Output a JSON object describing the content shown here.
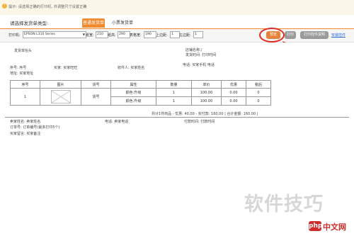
{
  "notice": {
    "icon": "info-icon",
    "text": "提示: 请选择正确的打印机, 并调整尺寸设置正确"
  },
  "type_selector": {
    "label": "请选择发货单类型:",
    "tabs": [
      {
        "label": "普通发货单",
        "active": true
      },
      {
        "label": "小票发货单",
        "active": false
      }
    ]
  },
  "print_settings": {
    "printer_label": "打印机:",
    "printer_value": "EPSON L310 Series",
    "width_label": "纸宽:",
    "width_value": "210",
    "height_label": "纸高:",
    "height_value": "290",
    "table_width_label": "表格宽:",
    "table_width_value": "190",
    "top_margin_label": "上边距:",
    "top_margin_value": "1",
    "left_margin_label": "左边距:",
    "left_margin_value": "1",
    "buttons": {
      "preview": "预览",
      "print": "打印",
      "control": "打印控件说明",
      "install": "安装控件"
    }
  },
  "document": {
    "title_left": "发货单抬头",
    "shop_name": "店铺名称:/",
    "send_time": "发货时间: 打印时间",
    "serial": "序号: 序号",
    "buyer": "买家: 买家旺旺",
    "buyer_name": "收件人: 买家姓名",
    "phone": "电话: 买家手机 电话",
    "address": "地址: 买家地址",
    "table": {
      "headers": [
        "序号",
        "图片",
        "货号",
        "属性",
        "数量",
        "单价",
        "优惠",
        "税后"
      ],
      "row_index": "1",
      "item_code": "货号",
      "sub_rows": [
        {
          "attr": "颜色:升级",
          "qty": "1",
          "price": "100.00",
          "discount": "0.00",
          "after": "0"
        },
        {
          "attr": "颜色:升级",
          "qty": "1",
          "price": "100.00",
          "discount": "0.00",
          "after": "0"
        }
      ]
    },
    "summary": "共计1件商品 - 优惠: 40.00 - 实付款: 160.00 | 合计金额: 160.00 |",
    "seller_name": "卖家姓名: 卖家姓名",
    "seller_phone": "电话: 卖家电话",
    "shipping_method": "付款时间: 付款时间",
    "order_no": "订单号: 订单编号(最多打印5个)",
    "buyer_note": "买家留言: 买家备注"
  },
  "watermark": {
    "main": "软件技巧",
    "logo_mark": "php",
    "logo_text": "中文网"
  }
}
